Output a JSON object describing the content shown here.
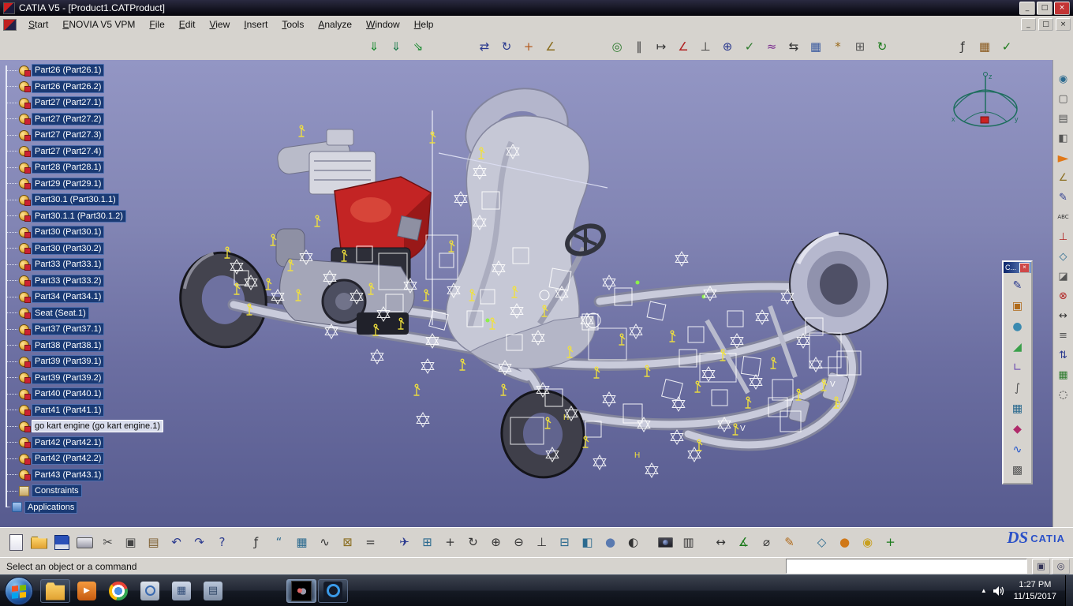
{
  "window": {
    "title": "CATIA V5 - [Product1.CATProduct]",
    "title_controls": [
      {
        "name": "minimize-button",
        "glyph": "_"
      },
      {
        "name": "maximize-button",
        "glyph": "□"
      },
      {
        "name": "close-button",
        "glyph": "×",
        "cls": "close"
      }
    ],
    "menu_controls": [
      {
        "name": "mdi-minimize-button",
        "glyph": "_"
      },
      {
        "name": "mdi-restore-button",
        "glyph": "□"
      },
      {
        "name": "mdi-close-button",
        "glyph": "×"
      }
    ]
  },
  "menubar": {
    "items": [
      "Start",
      "ENOVIA V5 VPM",
      "File",
      "Edit",
      "View",
      "Insert",
      "Tools",
      "Analyze",
      "Window",
      "Help"
    ]
  },
  "toolbars": {
    "top": [
      {
        "gap": 460
      },
      {
        "name": "new-component-icon",
        "glyph": "⇓",
        "fg": "#15892c"
      },
      {
        "name": "new-product-icon",
        "glyph": "⇓",
        "fg": "#1a7a4a"
      },
      {
        "name": "existing-component-icon",
        "glyph": "⇘",
        "fg": "#15892c"
      },
      {
        "gap": 56
      },
      {
        "name": "translate-component-icon",
        "glyph": "⇄",
        "fg": "#2b3a8f"
      },
      {
        "name": "rotate-component-icon",
        "glyph": "↻",
        "fg": "#2b3a8f"
      },
      {
        "name": "manipulate-icon",
        "glyph": "+",
        "fg": "#b35a1f"
      },
      {
        "name": "snap-components-icon",
        "glyph": "∠",
        "fg": "#8a6d1f"
      },
      {
        "gap": 56
      },
      {
        "name": "coincidence-constraint-icon",
        "glyph": "◎",
        "fg": "#2b7a2b"
      },
      {
        "name": "contact-constraint-icon",
        "glyph": "∥",
        "fg": "#333333"
      },
      {
        "name": "offset-constraint-icon",
        "glyph": "↦",
        "fg": "#333333"
      },
      {
        "name": "angle-constraint-icon",
        "glyph": "∠",
        "fg": "#b02020"
      },
      {
        "name": "anchor-constraint-icon",
        "glyph": "⊥",
        "fg": "#333333"
      },
      {
        "name": "fix-together-icon",
        "glyph": "⊕",
        "fg": "#2b3a8f"
      },
      {
        "name": "quick-constraint-icon",
        "glyph": "✓",
        "fg": "#2b7a2b"
      },
      {
        "name": "flexible-assembly-icon",
        "glyph": "≈",
        "fg": "#7a2b8f"
      },
      {
        "name": "change-constraint-icon",
        "glyph": "⇆",
        "fg": "#333333"
      },
      {
        "name": "reuse-pattern-icon",
        "glyph": "▦",
        "fg": "#3a5a9f"
      },
      {
        "name": "gear-pair-icon",
        "glyph": "*",
        "fg": "#9a6a1a"
      },
      {
        "name": "smart-fastener-icon",
        "glyph": "⊞",
        "fg": "#555555"
      },
      {
        "name": "update-assembly-icon",
        "glyph": "↻",
        "fg": "#1a7a1a"
      },
      {
        "gap": 74
      },
      {
        "name": "formula-icon",
        "glyph": "ƒ",
        "fg": "#333333"
      },
      {
        "name": "design-table-icon",
        "glyph": "▦",
        "fg": "#8a5a1f"
      },
      {
        "name": "check-rule-icon",
        "glyph": "✓",
        "fg": "#1a7a1a"
      }
    ],
    "right": [
      {
        "name": "fly-through-icon",
        "glyph": "◉",
        "fg": "#2b6a8f"
      },
      {
        "name": "view-frame-icon",
        "glyph": "▢",
        "fg": "#555555"
      },
      {
        "name": "named-views-icon",
        "glyph": "▤",
        "fg": "#555555"
      },
      {
        "name": "render-style-icon",
        "glyph": "◧",
        "fg": "#555555"
      },
      {
        "gap": 58
      },
      {
        "name": "select-arrow-icon",
        "glyph": "►",
        "fg": "#e07818",
        "fs": 18
      },
      {
        "gap": 18
      },
      {
        "name": "snap-icon",
        "glyph": "∠",
        "fg": "#8a6d1f"
      },
      {
        "name": "sketcher-icon",
        "glyph": "✎",
        "fg": "#2b3a8f"
      },
      {
        "name": "text-annotation-icon",
        "glyph": "ABC",
        "fg": "#333333",
        "fs": 7
      },
      {
        "name": "axis-system-icon",
        "glyph": "⊥",
        "fg": "#b02020"
      },
      {
        "name": "plane-icon",
        "glyph": "◇",
        "fg": "#2b6a8f"
      },
      {
        "name": "section-icon",
        "glyph": "◪",
        "fg": "#555555"
      },
      {
        "name": "clash-icon",
        "glyph": "⊗",
        "fg": "#b02020"
      },
      {
        "name": "measure-icon",
        "glyph": "↔",
        "fg": "#333333"
      },
      {
        "name": "annotation-list-icon",
        "glyph": "≡",
        "fg": "#555555"
      },
      {
        "name": "swap-visible-space-icon",
        "glyph": "⇅",
        "fg": "#2b3a8f"
      },
      {
        "name": "graph-icon",
        "glyph": "▦",
        "fg": "#2b7a2b"
      },
      {
        "name": "magnifier-icon",
        "glyph": "◌",
        "fg": "#333333"
      }
    ],
    "bottom": [
      {
        "name": "new-document-icon",
        "cls": "shape-page"
      },
      {
        "name": "open-icon",
        "cls": "shape-folder"
      },
      {
        "name": "save-icon",
        "cls": "shape-floppy"
      },
      {
        "name": "print-icon",
        "cls": "shape-printer"
      },
      {
        "name": "cut-icon",
        "glyph": "✂",
        "fg": "#444444"
      },
      {
        "name": "copy-icon",
        "glyph": "▣",
        "fg": "#444444"
      },
      {
        "name": "paste-icon",
        "glyph": "▤",
        "fg": "#7a5a2a"
      },
      {
        "name": "undo-icon",
        "glyph": "↶",
        "fg": "#2b3a8f"
      },
      {
        "name": "redo-icon",
        "glyph": "↷",
        "fg": "#2b3a8f"
      },
      {
        "name": "whats-this-icon",
        "glyph": "?",
        "fg": "#2b3a8f"
      },
      {
        "gap": 14
      },
      {
        "name": "formula-fog-icon",
        "glyph": "ƒ",
        "fg": "#333333"
      },
      {
        "name": "comment-icon",
        "glyph": "“",
        "fg": "#2b6a8f"
      },
      {
        "name": "design-table-icon",
        "glyph": "▦",
        "fg": "#2b6a8f"
      },
      {
        "name": "law-icon",
        "glyph": "∿",
        "fg": "#333333"
      },
      {
        "name": "lock-icon",
        "glyph": "⊠",
        "fg": "#8a6d1f"
      },
      {
        "name": "equivalent-dimensions-icon",
        "glyph": "=",
        "fg": "#333333"
      },
      {
        "gap": 14
      },
      {
        "name": "fly-mode-icon",
        "glyph": "✈",
        "fg": "#2b3a8f"
      },
      {
        "name": "fit-all-in-icon",
        "glyph": "⊞",
        "fg": "#2b6a8f"
      },
      {
        "name": "pan-icon",
        "glyph": "+",
        "fg": "#333333"
      },
      {
        "name": "rotate-view-icon",
        "glyph": "↻",
        "fg": "#333333"
      },
      {
        "name": "zoom-in-icon",
        "glyph": "⊕",
        "fg": "#333333"
      },
      {
        "name": "zoom-out-icon",
        "glyph": "⊖",
        "fg": "#333333"
      },
      {
        "name": "normal-view-icon",
        "glyph": "⊥",
        "fg": "#333333"
      },
      {
        "name": "create-multi-view-icon",
        "glyph": "⊟",
        "fg": "#2b6a8f"
      },
      {
        "name": "quick-view-icon",
        "glyph": "◧",
        "fg": "#2b6a8f"
      },
      {
        "name": "shading-icon",
        "glyph": "●",
        "fg": "#5a7ab0"
      },
      {
        "name": "hide-show-icon",
        "glyph": "◐",
        "fg": "#333333"
      },
      {
        "gap": 12
      },
      {
        "name": "camera-icon",
        "cls": "shape-camera"
      },
      {
        "name": "film-icon",
        "glyph": "▥",
        "fg": "#333333"
      },
      {
        "gap": 12
      },
      {
        "name": "ruler-icon",
        "glyph": "↔",
        "fg": "#333333"
      },
      {
        "name": "measure-between-icon",
        "glyph": "∡",
        "fg": "#1a7a1a"
      },
      {
        "name": "measure-inertia-icon",
        "glyph": "⌀",
        "fg": "#333333"
      },
      {
        "name": "annotations-icon",
        "glyph": "✎",
        "fg": "#b06a1a"
      },
      {
        "gap": 12
      },
      {
        "name": "catalog-browser-icon",
        "glyph": "◇",
        "fg": "#2b6a8f"
      },
      {
        "name": "apply-material-icon",
        "glyph": "●",
        "fg": "#d07818"
      },
      {
        "name": "render-icon",
        "glyph": "◉",
        "fg": "#c8a020"
      },
      {
        "name": "graph-tool-icon",
        "glyph": "+",
        "fg": "#1a7a1a"
      }
    ]
  },
  "palette": {
    "title": "C...",
    "close_glyph": "×",
    "icons": [
      {
        "name": "pen-icon",
        "glyph": "✎",
        "fg": "#2b3a8f"
      },
      {
        "name": "solid-box-icon",
        "glyph": "▣",
        "fg": "#b06a1a"
      },
      {
        "name": "cylinder-icon",
        "glyph": "●",
        "fg": "#3a8ab0"
      },
      {
        "name": "triangle-ruler-icon",
        "glyph": "◢",
        "fg": "#3aa04a"
      },
      {
        "name": "square-angle-icon",
        "glyph": "∟",
        "fg": "#6a4ab0"
      },
      {
        "name": "paperclip-icon",
        "glyph": "∫",
        "fg": "#555555"
      },
      {
        "name": "table-icon",
        "glyph": "▦",
        "fg": "#2b6a8f"
      },
      {
        "name": "color-palette-icon",
        "glyph": "◆",
        "fg": "#b02a6a"
      },
      {
        "name": "spline-icon",
        "glyph": "∿",
        "fg": "#2255cc"
      },
      {
        "name": "dot-matrix-icon",
        "glyph": "▩",
        "fg": "#555555"
      }
    ]
  },
  "tree": {
    "items": [
      {
        "label": "Part26 (Part26.1)",
        "type": "part"
      },
      {
        "label": "Part26 (Part26.2)",
        "type": "part"
      },
      {
        "label": "Part27 (Part27.1)",
        "type": "part"
      },
      {
        "label": "Part27 (Part27.2)",
        "type": "part"
      },
      {
        "label": "Part27 (Part27.3)",
        "type": "part"
      },
      {
        "label": "Part27 (Part27.4)",
        "type": "part"
      },
      {
        "label": "Part28 (Part28.1)",
        "type": "part"
      },
      {
        "label": "Part29 (Part29.1)",
        "type": "part"
      },
      {
        "label": "Part30.1 (Part30.1.1)",
        "type": "part"
      },
      {
        "label": "Part30.1.1 (Part30.1.2)",
        "type": "part"
      },
      {
        "label": "Part30 (Part30.1)",
        "type": "part"
      },
      {
        "label": "Part30 (Part30.2)",
        "type": "part"
      },
      {
        "label": "Part33 (Part33.1)",
        "type": "part"
      },
      {
        "label": "Part33 (Part33.2)",
        "type": "part"
      },
      {
        "label": "Part34 (Part34.1)",
        "type": "part"
      },
      {
        "label": "Seat (Seat.1)",
        "type": "part"
      },
      {
        "label": "Part37 (Part37.1)",
        "type": "part"
      },
      {
        "label": "Part38 (Part38.1)",
        "type": "part"
      },
      {
        "label": "Part39 (Part39.1)",
        "type": "part"
      },
      {
        "label": "Part39 (Part39.2)",
        "type": "part"
      },
      {
        "label": "Part40 (Part40.1)",
        "type": "part"
      },
      {
        "label": "Part41 (Part41.1)",
        "type": "part"
      },
      {
        "label": "go kart engine (go kart engine.1)",
        "type": "part",
        "selected": true
      },
      {
        "label": "Part42 (Part42.1)",
        "type": "part"
      },
      {
        "label": "Part42 (Part42.2)",
        "type": "part"
      },
      {
        "label": "Part43 (Part43.1)",
        "type": "part"
      },
      {
        "label": "Constraints",
        "type": "constraints"
      },
      {
        "label": "Applications",
        "type": "applications"
      }
    ]
  },
  "statusbar": {
    "message": "Select an object or a command",
    "power_input": {
      "value": ""
    },
    "icons": [
      {
        "name": "expand-statusbar-icon",
        "glyph": "▣",
        "fg": "#335"
      },
      {
        "name": "power-input-toggle-icon",
        "glyph": "◎",
        "fg": "#335"
      }
    ]
  },
  "branding": {
    "ds": "DS",
    "catia": "CATIA"
  },
  "taskbar": {
    "apps": [
      {
        "name": "windows-explorer",
        "state": "running"
      },
      {
        "name": "media-player",
        "state": "pinned"
      },
      {
        "name": "chrome",
        "state": "pinned"
      },
      {
        "name": "snipping-tool",
        "state": "pinned"
      },
      {
        "name": "calculator",
        "state": "pinned"
      },
      {
        "name": "documents",
        "state": "pinned"
      },
      {
        "gap": 72
      },
      {
        "name": "catia",
        "state": "active"
      },
      {
        "name": "composer",
        "state": "running"
      }
    ],
    "tray_arrow_glyph": "▲",
    "clock": {
      "time": "1:27 PM",
      "date": "11/15/2017"
    }
  },
  "colors": {
    "viewport_top": "#9396c4",
    "viewport_bottom": "#575b8f",
    "tree_label_bg": "#1a3a74",
    "engine_red": "#c32424",
    "constraint_white": "#ffffff",
    "constraint_yellow": "#f2e23c",
    "taskbar_dark": "#0b0e15"
  }
}
